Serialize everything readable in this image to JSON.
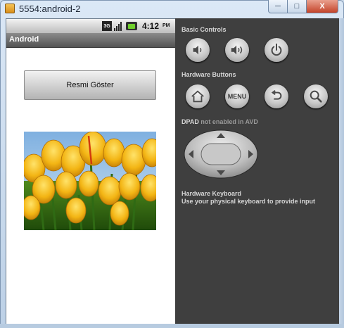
{
  "window": {
    "title": "5554:android-2",
    "min_label": "─",
    "max_label": "□",
    "close_label": "X"
  },
  "status_bar": {
    "network": "3G",
    "time": "4:12",
    "ampm": "PM"
  },
  "app": {
    "title": "Android",
    "button_label": "Resmi Göster",
    "image": "yellow-tulips-photo"
  },
  "controls": {
    "basic_label": "Basic Controls",
    "hardware_label": "Hardware Buttons",
    "dpad_label": "DPAD",
    "dpad_note": "not enabled in AVD",
    "menu_label": "MENU",
    "keyboard_title": "Hardware Keyboard",
    "keyboard_note": "Use your physical keyboard to provide input"
  },
  "colors": {
    "panel": "#3f3f3f",
    "battery": "#6fcf2c",
    "close": "#c4442a"
  }
}
